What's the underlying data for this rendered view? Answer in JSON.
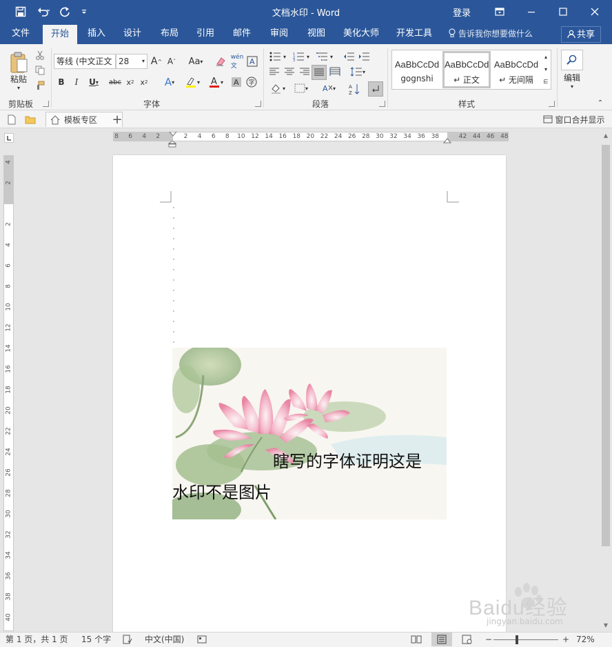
{
  "window": {
    "title": "文档水印 - Word",
    "signin": "登录"
  },
  "tabs": [
    "文件",
    "开始",
    "插入",
    "设计",
    "布局",
    "引用",
    "邮件",
    "审阅",
    "视图",
    "美化大师",
    "开发工具"
  ],
  "active_tab": "开始",
  "tellme": "告诉我你想要做什么",
  "share": "共享",
  "ribbon": {
    "clipboard": {
      "paste": "粘贴",
      "label": "剪贴板"
    },
    "font": {
      "name": "等线 (中文正文",
      "size": "28",
      "label": "字体",
      "case_btn": "Aa"
    },
    "paragraph": {
      "label": "段落"
    },
    "styles": {
      "label": "样式",
      "items": [
        {
          "sample": "AaBbCcDd",
          "name": "gognshi"
        },
        {
          "sample": "AaBbCcDd",
          "name": "↵ 正文"
        },
        {
          "sample": "AaBbCcDd",
          "name": "↵ 无间隔"
        }
      ]
    },
    "editing": {
      "label": "编辑"
    }
  },
  "doctabs": {
    "template_tab": "模板专区",
    "merge_windows": "窗口合并显示"
  },
  "hruler_ticks": [
    "8",
    "6",
    "4",
    "2",
    "",
    "2",
    "4",
    "6",
    "8",
    "10",
    "12",
    "14",
    "16",
    "18",
    "20",
    "22",
    "24",
    "26",
    "28",
    "30",
    "32",
    "34",
    "36",
    "38",
    "",
    "42",
    "44",
    "46",
    "48"
  ],
  "vruler_ticks": [
    "4",
    "2",
    "",
    "2",
    "4",
    "6",
    "8",
    "10",
    "12",
    "14",
    "16",
    "18",
    "20",
    "22",
    "24",
    "26",
    "28",
    "30",
    "32",
    "34",
    "36",
    "38",
    "40"
  ],
  "document": {
    "line1": "瞎写的字体证明这是",
    "line2": "水印不是图片"
  },
  "status": {
    "page": "第 1 页，共 1 页",
    "words": "15 个字",
    "language": "中文(中国)",
    "zoom": "72%"
  },
  "watermark": {
    "brand": "Baidu经验",
    "url": "jingyan.baidu.com"
  },
  "colors": {
    "brand": "#2b579a",
    "ribbon_bg": "#f3f3f3",
    "font_color_bar": "#e3201b",
    "highlight_bar": "#fff200"
  }
}
